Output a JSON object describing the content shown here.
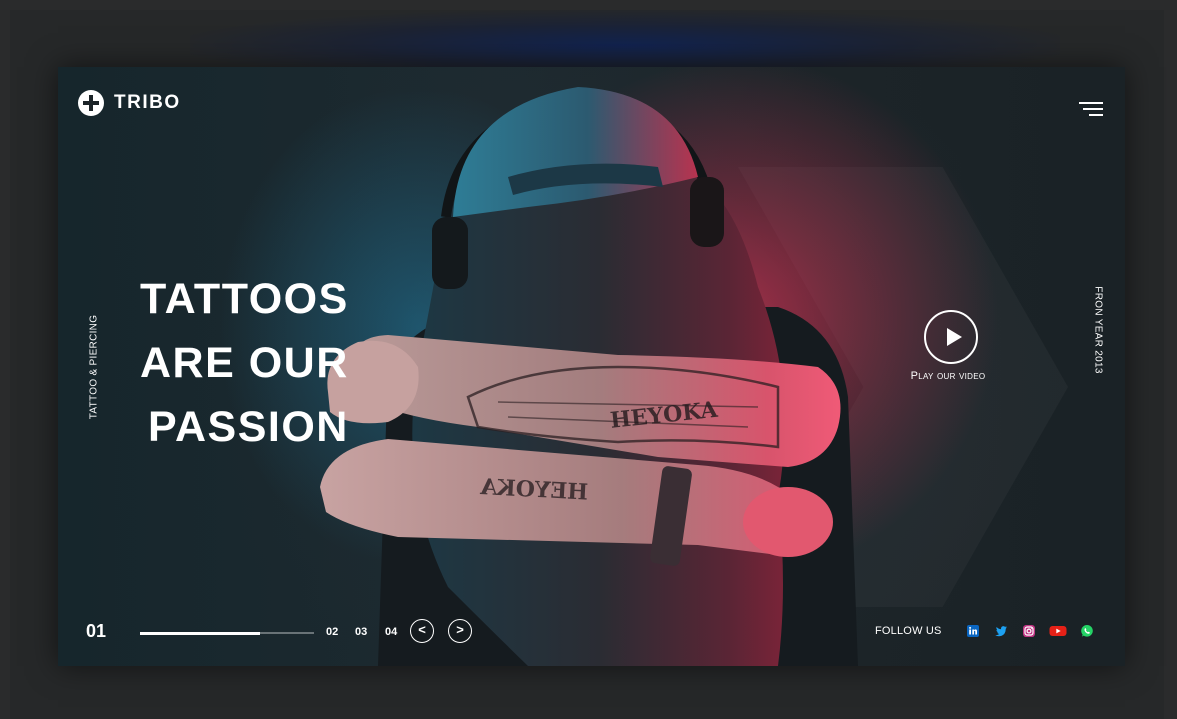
{
  "brand": {
    "name": "TRIBO"
  },
  "hero": {
    "headline_lines": [
      "TATTOOS",
      "ARE OUR",
      "PASSION"
    ],
    "side_left_text": "TATTOO & PIERCING",
    "side_right_text": "FRON YEAR 2013",
    "play_label": "Play our video"
  },
  "slider": {
    "current": "01",
    "progress": 0.69,
    "others": [
      "02",
      "03",
      "04"
    ],
    "prev_label": "<",
    "next_label": ">"
  },
  "social": {
    "follow_label": "FOLLOW US",
    "icons": [
      "linkedin-icon",
      "twitter-icon",
      "instagram-icon",
      "youtube-icon",
      "whatsapp-icon"
    ],
    "colors": {
      "linkedin": "#0a66c2",
      "twitter": "#1da1f2",
      "instagram": "#c13584",
      "youtube": "#e62117",
      "whatsapp": "#25d366"
    }
  },
  "colors": {
    "background": "#1b2327",
    "text": "#ffffff",
    "accent_red": "#e0294a",
    "accent_blue": "#1f6f8f"
  }
}
